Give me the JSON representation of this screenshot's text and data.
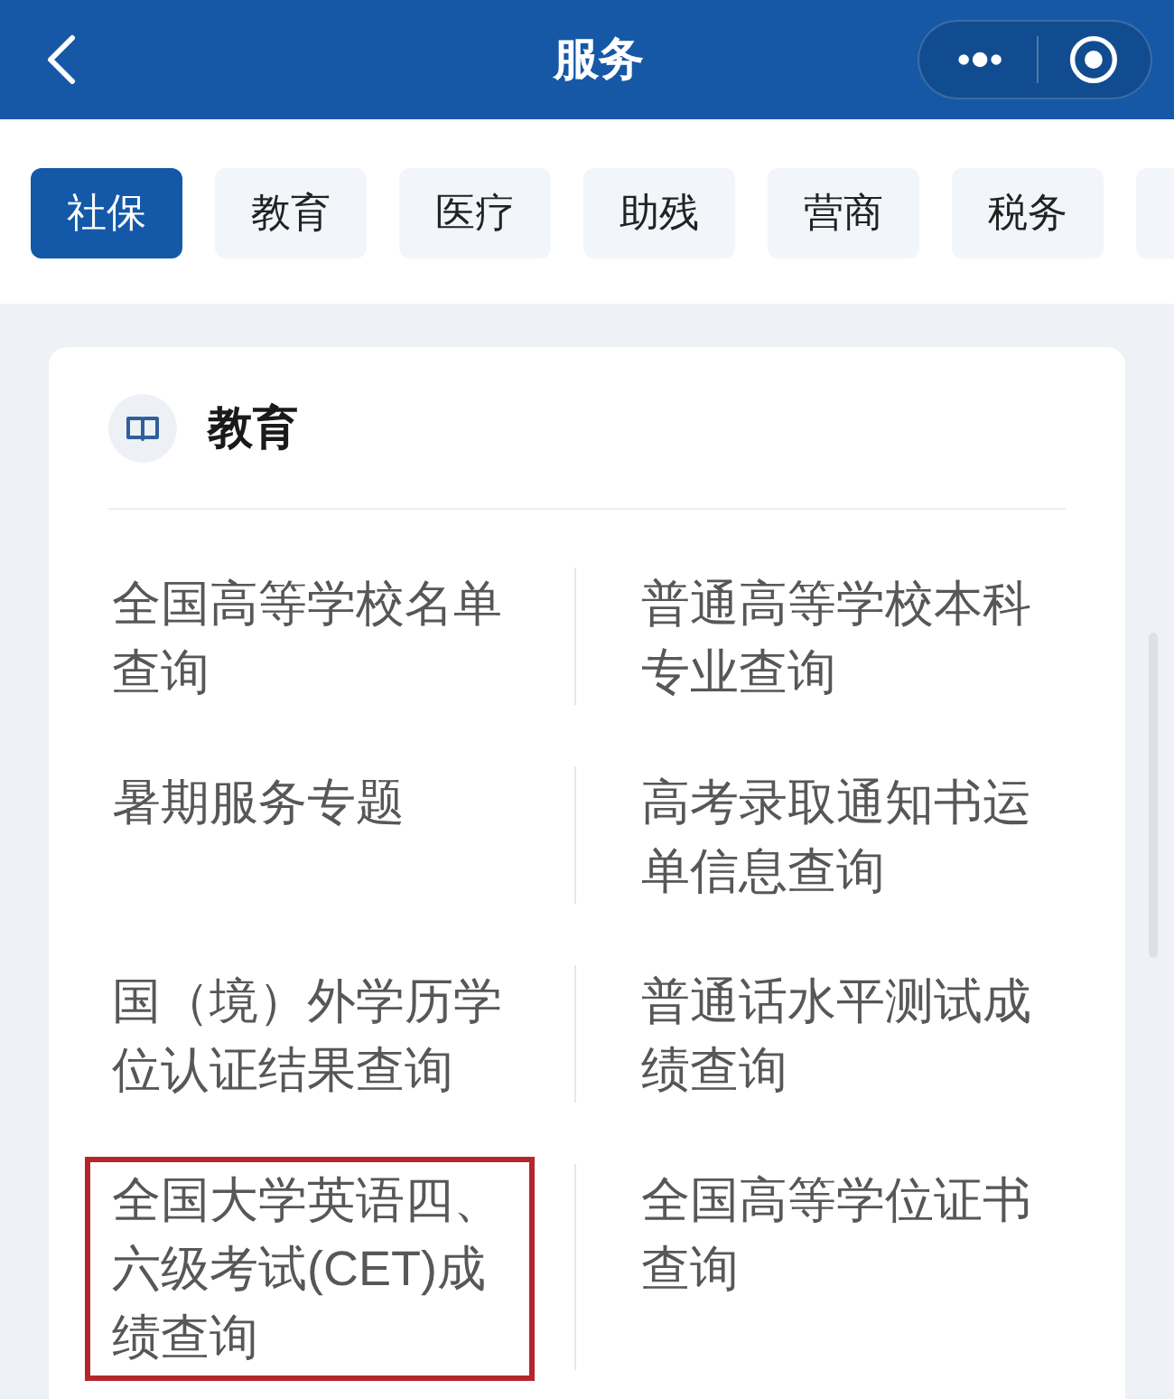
{
  "nav_bar": {
    "title": "服务"
  },
  "tabs": [
    {
      "label": "社保",
      "selected": true
    },
    {
      "label": "教育",
      "selected": false
    },
    {
      "label": "医疗",
      "selected": false
    },
    {
      "label": "助残",
      "selected": false
    },
    {
      "label": "营商",
      "selected": false
    },
    {
      "label": "税务",
      "selected": false
    },
    {
      "selected": false
    }
  ],
  "section": {
    "title": "教育",
    "items": [
      {
        "label": "全国高等学校名单查询",
        "highlighted": false
      },
      {
        "label": "普通高等学校本科专业查询",
        "highlighted": false
      },
      {
        "label": "暑期服务专题",
        "highlighted": false
      },
      {
        "label": "高考录取通知书运单信息查询",
        "highlighted": false
      },
      {
        "label": "国（境）外学历学位认证结果查询",
        "highlighted": false
      },
      {
        "label": "普通话水平测试成绩查询",
        "highlighted": false
      },
      {
        "label": "全国大学英语四、六级考试(CET)成绩查询",
        "highlighted": true
      },
      {
        "label": "全国高等学位证书查询",
        "highlighted": false
      }
    ]
  }
}
